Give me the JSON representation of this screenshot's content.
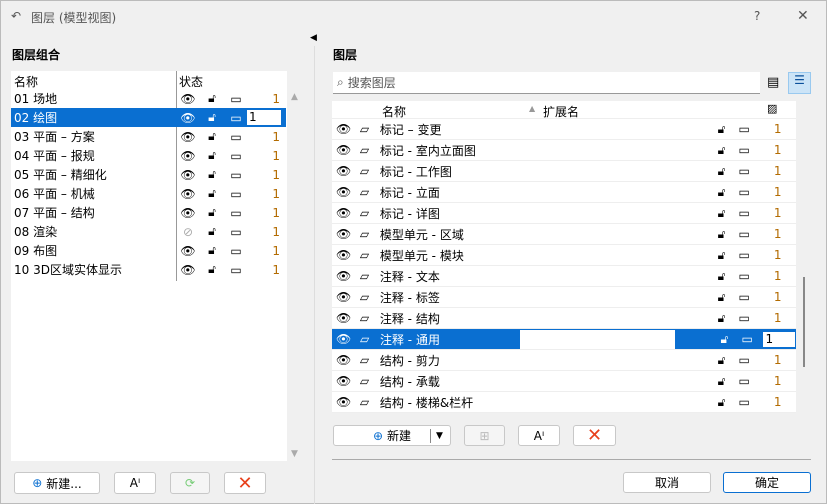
{
  "window": {
    "title": "图层 (模型视图)",
    "help": "?",
    "close": "✕"
  },
  "left": {
    "heading": "图层组合",
    "col_name": "名称",
    "col_status": "状态",
    "rows": [
      {
        "name": "01 场地",
        "visible": true,
        "num": "1"
      },
      {
        "name": "02 绘图",
        "visible": true,
        "num": "1",
        "selected": true
      },
      {
        "name": "03 平面 – 方案",
        "visible": true,
        "num": "1"
      },
      {
        "name": "04 平面 – 报规",
        "visible": true,
        "num": "1"
      },
      {
        "name": "05 平面 – 精细化",
        "visible": true,
        "num": "1"
      },
      {
        "name": "06 平面 – 机械",
        "visible": true,
        "num": "1"
      },
      {
        "name": "07 平面 – 结构",
        "visible": true,
        "num": "1"
      },
      {
        "name": "08 渲染",
        "visible": false,
        "num": "1"
      },
      {
        "name": "09 布图",
        "visible": true,
        "num": "1"
      },
      {
        "name": "10 3D区域实体显示",
        "visible": true,
        "num": "1"
      }
    ],
    "new_label": "新建..."
  },
  "right": {
    "heading": "图层",
    "search_placeholder": "搜索图层",
    "col_name": "名称",
    "col_ext": "扩展名",
    "rows": [
      {
        "name": "标记 – 变更",
        "num": "1"
      },
      {
        "name": "标记 - 室内立面图",
        "num": "1"
      },
      {
        "name": "标记 - 工作图",
        "num": "1"
      },
      {
        "name": "标记 - 立面",
        "num": "1"
      },
      {
        "name": "标记 - 详图",
        "num": "1"
      },
      {
        "name": "模型单元 - 区域",
        "num": "1"
      },
      {
        "name": "模型单元 - 模块",
        "num": "1"
      },
      {
        "name": "注释 - 文本",
        "num": "1"
      },
      {
        "name": "注释 - 标签",
        "num": "1"
      },
      {
        "name": "注释 - 结构",
        "num": "1"
      },
      {
        "name": "注释 - 通用",
        "num": "1",
        "selected": true
      },
      {
        "name": "结构 - 剪力",
        "num": "1"
      },
      {
        "name": "结构 - 承载",
        "num": "1"
      },
      {
        "name": "结构 - 楼梯&栏杆",
        "num": "1"
      }
    ],
    "new_label": "新建"
  },
  "footer": {
    "cancel": "取消",
    "ok": "确定"
  },
  "colors": {
    "accent": "#0a6fd1",
    "number": "#b36b00",
    "delete": "#e8401c"
  }
}
